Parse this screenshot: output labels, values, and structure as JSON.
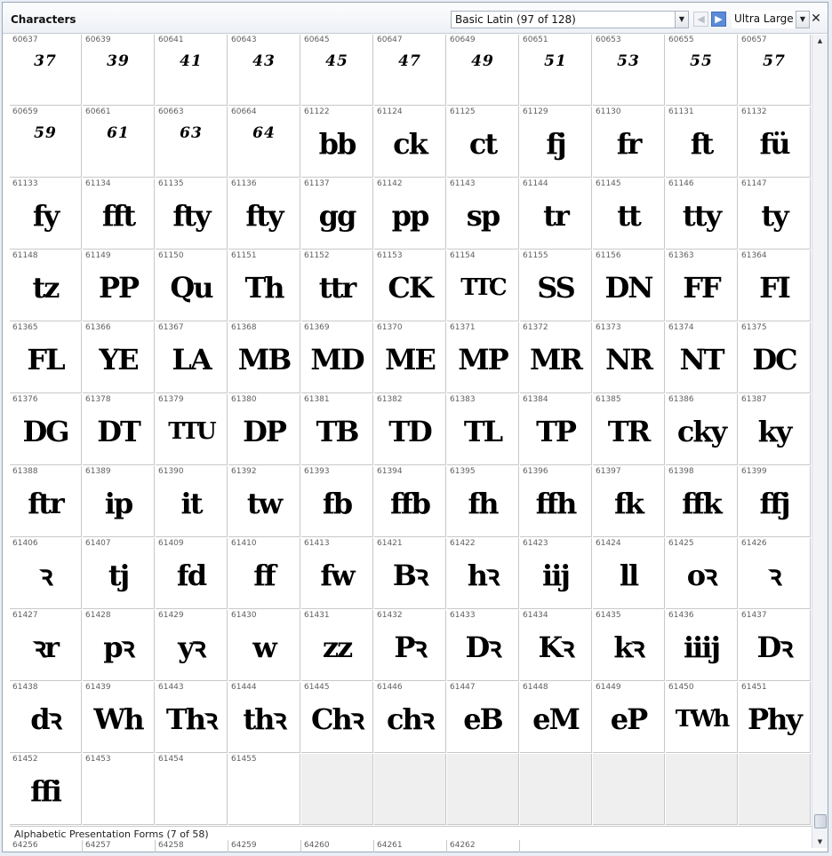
{
  "window": {
    "title": "Characters",
    "range_select": "Basic Latin (97 of 128)",
    "size_select": "Ultra Large",
    "prev_icon": "arrow-left-icon",
    "next_icon": "arrow-right-icon",
    "close_glyph": "✕"
  },
  "cells": [
    {
      "code": "60637",
      "glyph": "37",
      "style": "num"
    },
    {
      "code": "60639",
      "glyph": "39",
      "style": "num"
    },
    {
      "code": "60641",
      "glyph": "41",
      "style": "num"
    },
    {
      "code": "60643",
      "glyph": "43",
      "style": "num"
    },
    {
      "code": "60645",
      "glyph": "45",
      "style": "num"
    },
    {
      "code": "60647",
      "glyph": "47",
      "style": "num"
    },
    {
      "code": "60649",
      "glyph": "49",
      "style": "num"
    },
    {
      "code": "60651",
      "glyph": "51",
      "style": "num"
    },
    {
      "code": "60653",
      "glyph": "53",
      "style": "num"
    },
    {
      "code": "60655",
      "glyph": "55",
      "style": "num"
    },
    {
      "code": "60657",
      "glyph": "57",
      "style": "num"
    },
    {
      "code": "60659",
      "glyph": "59",
      "style": "num"
    },
    {
      "code": "60661",
      "glyph": "61",
      "style": "num"
    },
    {
      "code": "60663",
      "glyph": "63",
      "style": "num"
    },
    {
      "code": "60664",
      "glyph": "64",
      "style": "num"
    },
    {
      "code": "61122",
      "glyph": "bb",
      "style": ""
    },
    {
      "code": "61124",
      "glyph": "ck",
      "style": ""
    },
    {
      "code": "61125",
      "glyph": "ct",
      "style": ""
    },
    {
      "code": "61129",
      "glyph": "fj",
      "style": ""
    },
    {
      "code": "61130",
      "glyph": "fr",
      "style": ""
    },
    {
      "code": "61131",
      "glyph": "ft",
      "style": ""
    },
    {
      "code": "61132",
      "glyph": "fü",
      "style": ""
    },
    {
      "code": "61133",
      "glyph": "fy",
      "style": ""
    },
    {
      "code": "61134",
      "glyph": "fft",
      "style": ""
    },
    {
      "code": "61135",
      "glyph": "fty",
      "style": ""
    },
    {
      "code": "61136",
      "glyph": "fty",
      "style": ""
    },
    {
      "code": "61137",
      "glyph": "gg",
      "style": ""
    },
    {
      "code": "61142",
      "glyph": "pp",
      "style": ""
    },
    {
      "code": "61143",
      "glyph": "sp",
      "style": ""
    },
    {
      "code": "61144",
      "glyph": "tr",
      "style": ""
    },
    {
      "code": "61145",
      "glyph": "tt",
      "style": ""
    },
    {
      "code": "61146",
      "glyph": "tty",
      "style": ""
    },
    {
      "code": "61147",
      "glyph": "ty",
      "style": ""
    },
    {
      "code": "61148",
      "glyph": "tz",
      "style": ""
    },
    {
      "code": "61149",
      "glyph": "PP",
      "style": ""
    },
    {
      "code": "61150",
      "glyph": "Qu",
      "style": ""
    },
    {
      "code": "61151",
      "glyph": "Th",
      "style": ""
    },
    {
      "code": "61152",
      "glyph": "ttr",
      "style": ""
    },
    {
      "code": "61153",
      "glyph": "CK",
      "style": ""
    },
    {
      "code": "61154",
      "glyph": "TTC",
      "style": "small"
    },
    {
      "code": "61155",
      "glyph": "SS",
      "style": ""
    },
    {
      "code": "61156",
      "glyph": "DN",
      "style": ""
    },
    {
      "code": "61363",
      "glyph": "FF",
      "style": ""
    },
    {
      "code": "61364",
      "glyph": "FI",
      "style": ""
    },
    {
      "code": "61365",
      "glyph": "FL",
      "style": ""
    },
    {
      "code": "61366",
      "glyph": "YE",
      "style": ""
    },
    {
      "code": "61367",
      "glyph": "LA",
      "style": ""
    },
    {
      "code": "61368",
      "glyph": "MB",
      "style": ""
    },
    {
      "code": "61369",
      "glyph": "MD",
      "style": ""
    },
    {
      "code": "61370",
      "glyph": "ME",
      "style": ""
    },
    {
      "code": "61371",
      "glyph": "MP",
      "style": ""
    },
    {
      "code": "61372",
      "glyph": "MR",
      "style": ""
    },
    {
      "code": "61373",
      "glyph": "NR",
      "style": ""
    },
    {
      "code": "61374",
      "glyph": "NT",
      "style": ""
    },
    {
      "code": "61375",
      "glyph": "DC",
      "style": ""
    },
    {
      "code": "61376",
      "glyph": "DG",
      "style": ""
    },
    {
      "code": "61378",
      "glyph": "DT",
      "style": ""
    },
    {
      "code": "61379",
      "glyph": "TTU",
      "style": "small"
    },
    {
      "code": "61380",
      "glyph": "DP",
      "style": ""
    },
    {
      "code": "61381",
      "glyph": "TB",
      "style": ""
    },
    {
      "code": "61382",
      "glyph": "TD",
      "style": ""
    },
    {
      "code": "61383",
      "glyph": "TL",
      "style": ""
    },
    {
      "code": "61384",
      "glyph": "TP",
      "style": ""
    },
    {
      "code": "61385",
      "glyph": "TR",
      "style": ""
    },
    {
      "code": "61386",
      "glyph": "cky",
      "style": ""
    },
    {
      "code": "61387",
      "glyph": "ky",
      "style": ""
    },
    {
      "code": "61388",
      "glyph": "ftr",
      "style": ""
    },
    {
      "code": "61389",
      "glyph": "ip",
      "style": ""
    },
    {
      "code": "61390",
      "glyph": "it",
      "style": ""
    },
    {
      "code": "61392",
      "glyph": "tw",
      "style": ""
    },
    {
      "code": "61393",
      "glyph": "fb",
      "style": ""
    },
    {
      "code": "61394",
      "glyph": "ffb",
      "style": ""
    },
    {
      "code": "61395",
      "glyph": "fh",
      "style": ""
    },
    {
      "code": "61396",
      "glyph": "ffh",
      "style": ""
    },
    {
      "code": "61397",
      "glyph": "fk",
      "style": ""
    },
    {
      "code": "61398",
      "glyph": "ffk",
      "style": ""
    },
    {
      "code": "61399",
      "glyph": "ffj",
      "style": ""
    },
    {
      "code": "61406",
      "glyph": "ꝛ",
      "style": ""
    },
    {
      "code": "61407",
      "glyph": "tj",
      "style": ""
    },
    {
      "code": "61409",
      "glyph": "fd",
      "style": ""
    },
    {
      "code": "61410",
      "glyph": "ff",
      "style": ""
    },
    {
      "code": "61413",
      "glyph": "fw",
      "style": ""
    },
    {
      "code": "61421",
      "glyph": "Bꝛ",
      "style": ""
    },
    {
      "code": "61422",
      "glyph": "hꝛ",
      "style": ""
    },
    {
      "code": "61423",
      "glyph": "iij",
      "style": ""
    },
    {
      "code": "61424",
      "glyph": "ll",
      "style": ""
    },
    {
      "code": "61425",
      "glyph": "oꝛ",
      "style": ""
    },
    {
      "code": "61426",
      "glyph": "ꝛ",
      "style": ""
    },
    {
      "code": "61427",
      "glyph": "ꝛr",
      "style": ""
    },
    {
      "code": "61428",
      "glyph": "pꝛ",
      "style": ""
    },
    {
      "code": "61429",
      "glyph": "yꝛ",
      "style": ""
    },
    {
      "code": "61430",
      "glyph": "w",
      "style": ""
    },
    {
      "code": "61431",
      "glyph": "zz",
      "style": ""
    },
    {
      "code": "61432",
      "glyph": "Pꝛ",
      "style": ""
    },
    {
      "code": "61433",
      "glyph": "Dꝛ",
      "style": ""
    },
    {
      "code": "61434",
      "glyph": "Kꝛ",
      "style": ""
    },
    {
      "code": "61435",
      "glyph": "kꝛ",
      "style": ""
    },
    {
      "code": "61436",
      "glyph": "iiij",
      "style": ""
    },
    {
      "code": "61437",
      "glyph": "Dꝛ",
      "style": ""
    },
    {
      "code": "61438",
      "glyph": "dꝛ",
      "style": ""
    },
    {
      "code": "61439",
      "glyph": "Wh",
      "style": ""
    },
    {
      "code": "61443",
      "glyph": "Thꝛ",
      "style": ""
    },
    {
      "code": "61444",
      "glyph": "thꝛ",
      "style": ""
    },
    {
      "code": "61445",
      "glyph": "Chꝛ",
      "style": ""
    },
    {
      "code": "61446",
      "glyph": "chꝛ",
      "style": ""
    },
    {
      "code": "61447",
      "glyph": "eB",
      "style": ""
    },
    {
      "code": "61448",
      "glyph": "eM",
      "style": ""
    },
    {
      "code": "61449",
      "glyph": "eP",
      "style": ""
    },
    {
      "code": "61450",
      "glyph": "TWh",
      "style": "small"
    },
    {
      "code": "61451",
      "glyph": "Phy",
      "style": ""
    },
    {
      "code": "61452",
      "glyph": "ffi",
      "style": ""
    },
    {
      "code": "61453",
      "glyph": "",
      "style": ""
    },
    {
      "code": "61454",
      "glyph": "",
      "style": ""
    },
    {
      "code": "61455",
      "glyph": "",
      "style": ""
    }
  ],
  "section": {
    "label": "Alphabetic Presentation Forms (7 of 58)",
    "next_codes": [
      "64256",
      "64257",
      "64258",
      "64259",
      "64260",
      "64261",
      "64262"
    ]
  }
}
